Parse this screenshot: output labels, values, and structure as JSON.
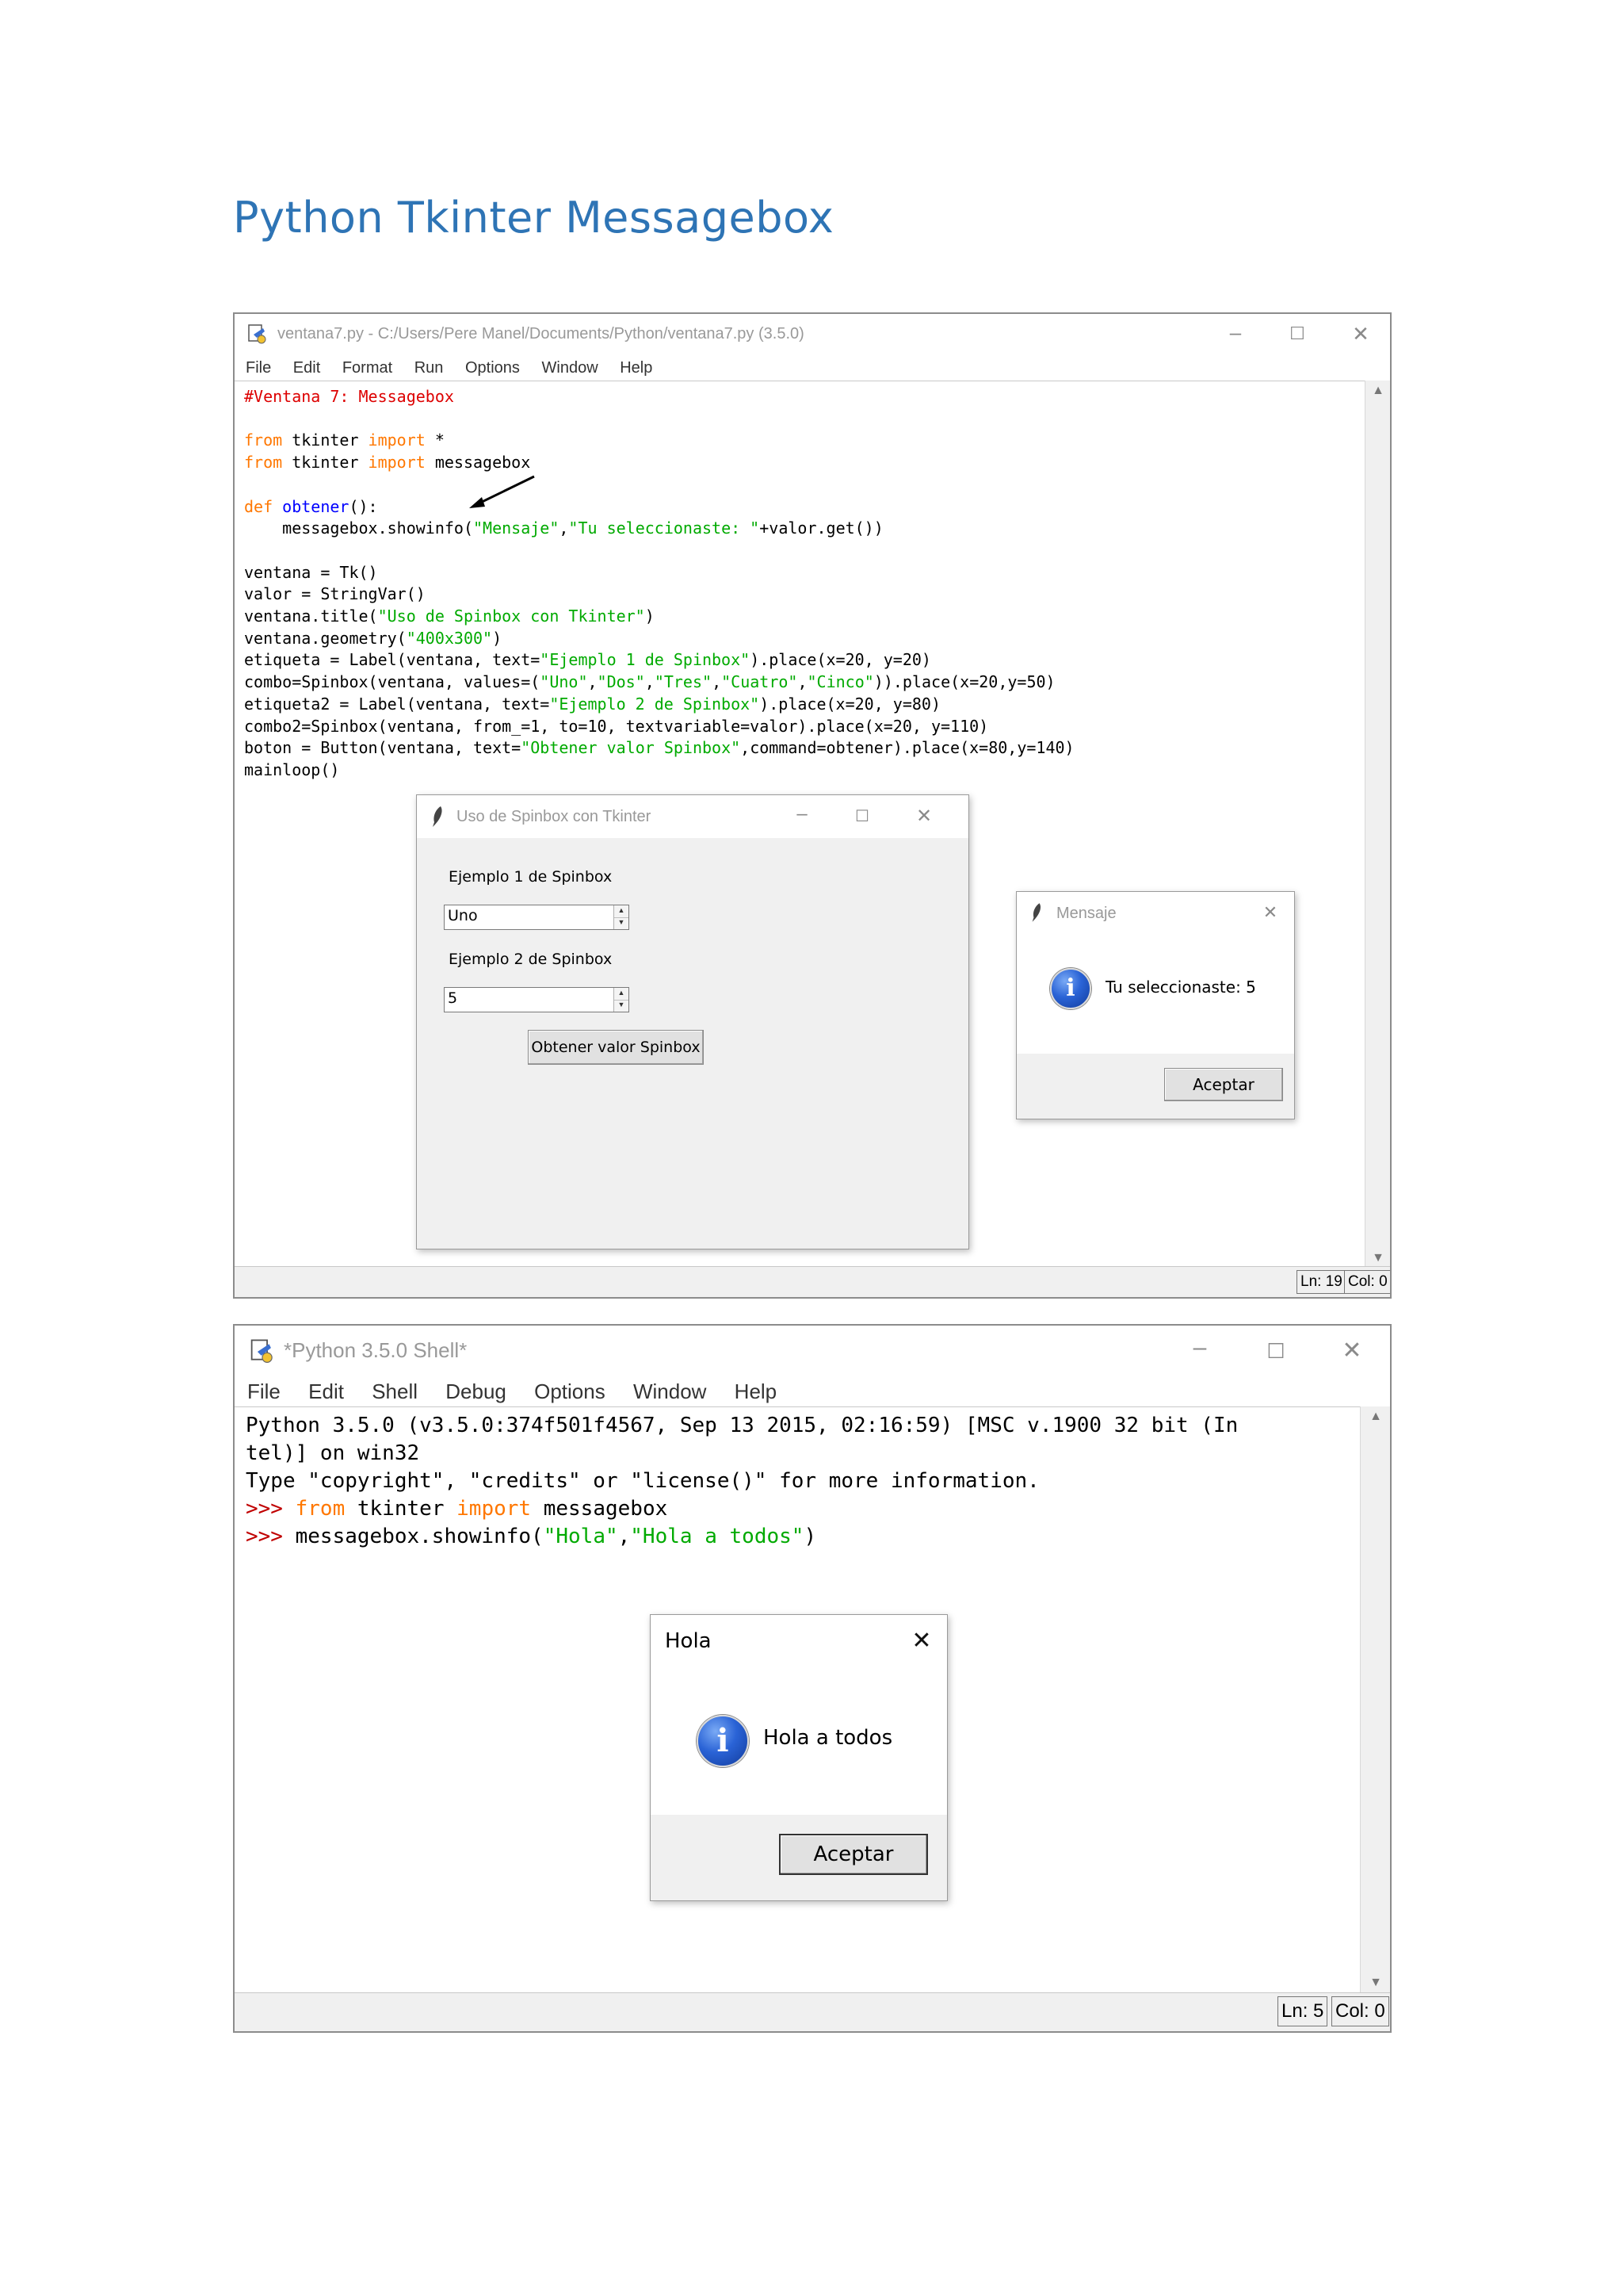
{
  "page_title": "Python Tkinter Messagebox",
  "editor_window": {
    "title": "ventana7.py - C:/Users/Pere Manel/Documents/Python/ventana7.py (3.5.0)",
    "menu": [
      "File",
      "Edit",
      "Format",
      "Run",
      "Options",
      "Window",
      "Help"
    ],
    "code": {
      "l1": "#Ventana 7: Messagebox",
      "l3_kw1": "from",
      "l3_mid": " tkinter ",
      "l3_kw2": "import",
      "l3_end": " *",
      "l4_kw1": "from",
      "l4_mid": " tkinter ",
      "l4_kw2": "import",
      "l4_end": " messagebox",
      "l6_kw": "def",
      "l6_name": "obtener",
      "l6_end": "():",
      "l7_a": "    messagebox.showinfo(",
      "l7_s1": "\"Mensaje\"",
      "l7_c": ",",
      "l7_s2": "\"Tu seleccionaste: \"",
      "l7_b": "+valor.get())",
      "l9": "ventana = Tk()",
      "l10": "valor = StringVar()",
      "l11_a": "ventana.title(",
      "l11_s": "\"Uso de Spinbox con Tkinter\"",
      "l11_b": ")",
      "l12_a": "ventana.geometry(",
      "l12_s": "\"400x300\"",
      "l12_b": ")",
      "l13_a": "etiqueta = Label(ventana, text=",
      "l13_s": "\"Ejemplo 1 de Spinbox\"",
      "l13_b": ").place(x=20, y=20)",
      "l14_a": "combo=Spinbox(ventana, values=(",
      "l14_s1": "\"Uno\"",
      "l14_s2": "\"Dos\"",
      "l14_s3": "\"Tres\"",
      "l14_s4": "\"Cuatro\"",
      "l14_s5": "\"Cinco\"",
      "l14_b": ")).place(x=20,y=50)",
      "l15_a": "etiqueta2 = Label(ventana, text=",
      "l15_s": "\"Ejemplo 2 de Spinbox\"",
      "l15_b": ").place(x=20, y=80)",
      "l16": "combo2=Spinbox(ventana, from_=1, to=10, textvariable=valor).place(x=20, y=110)",
      "l17_a": "boton = Button(ventana, text=",
      "l17_s": "\"Obtener valor Spinbox\"",
      "l17_b": ",command=obtener).place(x=80,y=140)",
      "l18": "mainloop()"
    },
    "status_ln": "Ln: 19",
    "status_col": "Col: 0"
  },
  "spinbox_app": {
    "title": "Uso de Spinbox con Tkinter",
    "label1": "Ejemplo 1 de Spinbox",
    "spin1_value": "Uno",
    "label2": "Ejemplo 2 de Spinbox",
    "spin2_value": "5",
    "button_label": "Obtener valor Spinbox"
  },
  "mensaje_dialog": {
    "title": "Mensaje",
    "message": "Tu seleccionaste: 5",
    "button_label": "Aceptar"
  },
  "shell_window": {
    "title": "*Python 3.5.0 Shell*",
    "menu": [
      "File",
      "Edit",
      "Shell",
      "Debug",
      "Options",
      "Window",
      "Help"
    ],
    "lines": {
      "l1": "Python 3.5.0 (v3.5.0:374f501f4567, Sep 13 2015, 02:16:59) [MSC v.1900 32 bit (In",
      "l2": "tel)] on win32",
      "l3": "Type \"copyright\", \"credits\" or \"license()\" for more information.",
      "l4_prompt": ">>> ",
      "l4_kw1": "from",
      "l4_mid": " tkinter ",
      "l4_kw2": "import",
      "l4_end": " messagebox",
      "l5_prompt": ">>> ",
      "l5_a": "messagebox.showinfo(",
      "l5_s1": "\"Hola\"",
      "l5_c": ",",
      "l5_s2": "\"Hola a todos\"",
      "l5_b": ")"
    },
    "status_ln": "Ln: 5",
    "status_col": "Col: 0"
  },
  "hola_dialog": {
    "title": "Hola",
    "message": "Hola a todos",
    "button_label": "Aceptar"
  },
  "colors": {
    "keyword": "#ff7700",
    "definition": "#0000ff",
    "string": "#00aa00",
    "comment": "#dd0000",
    "title": "#2e74b5"
  }
}
